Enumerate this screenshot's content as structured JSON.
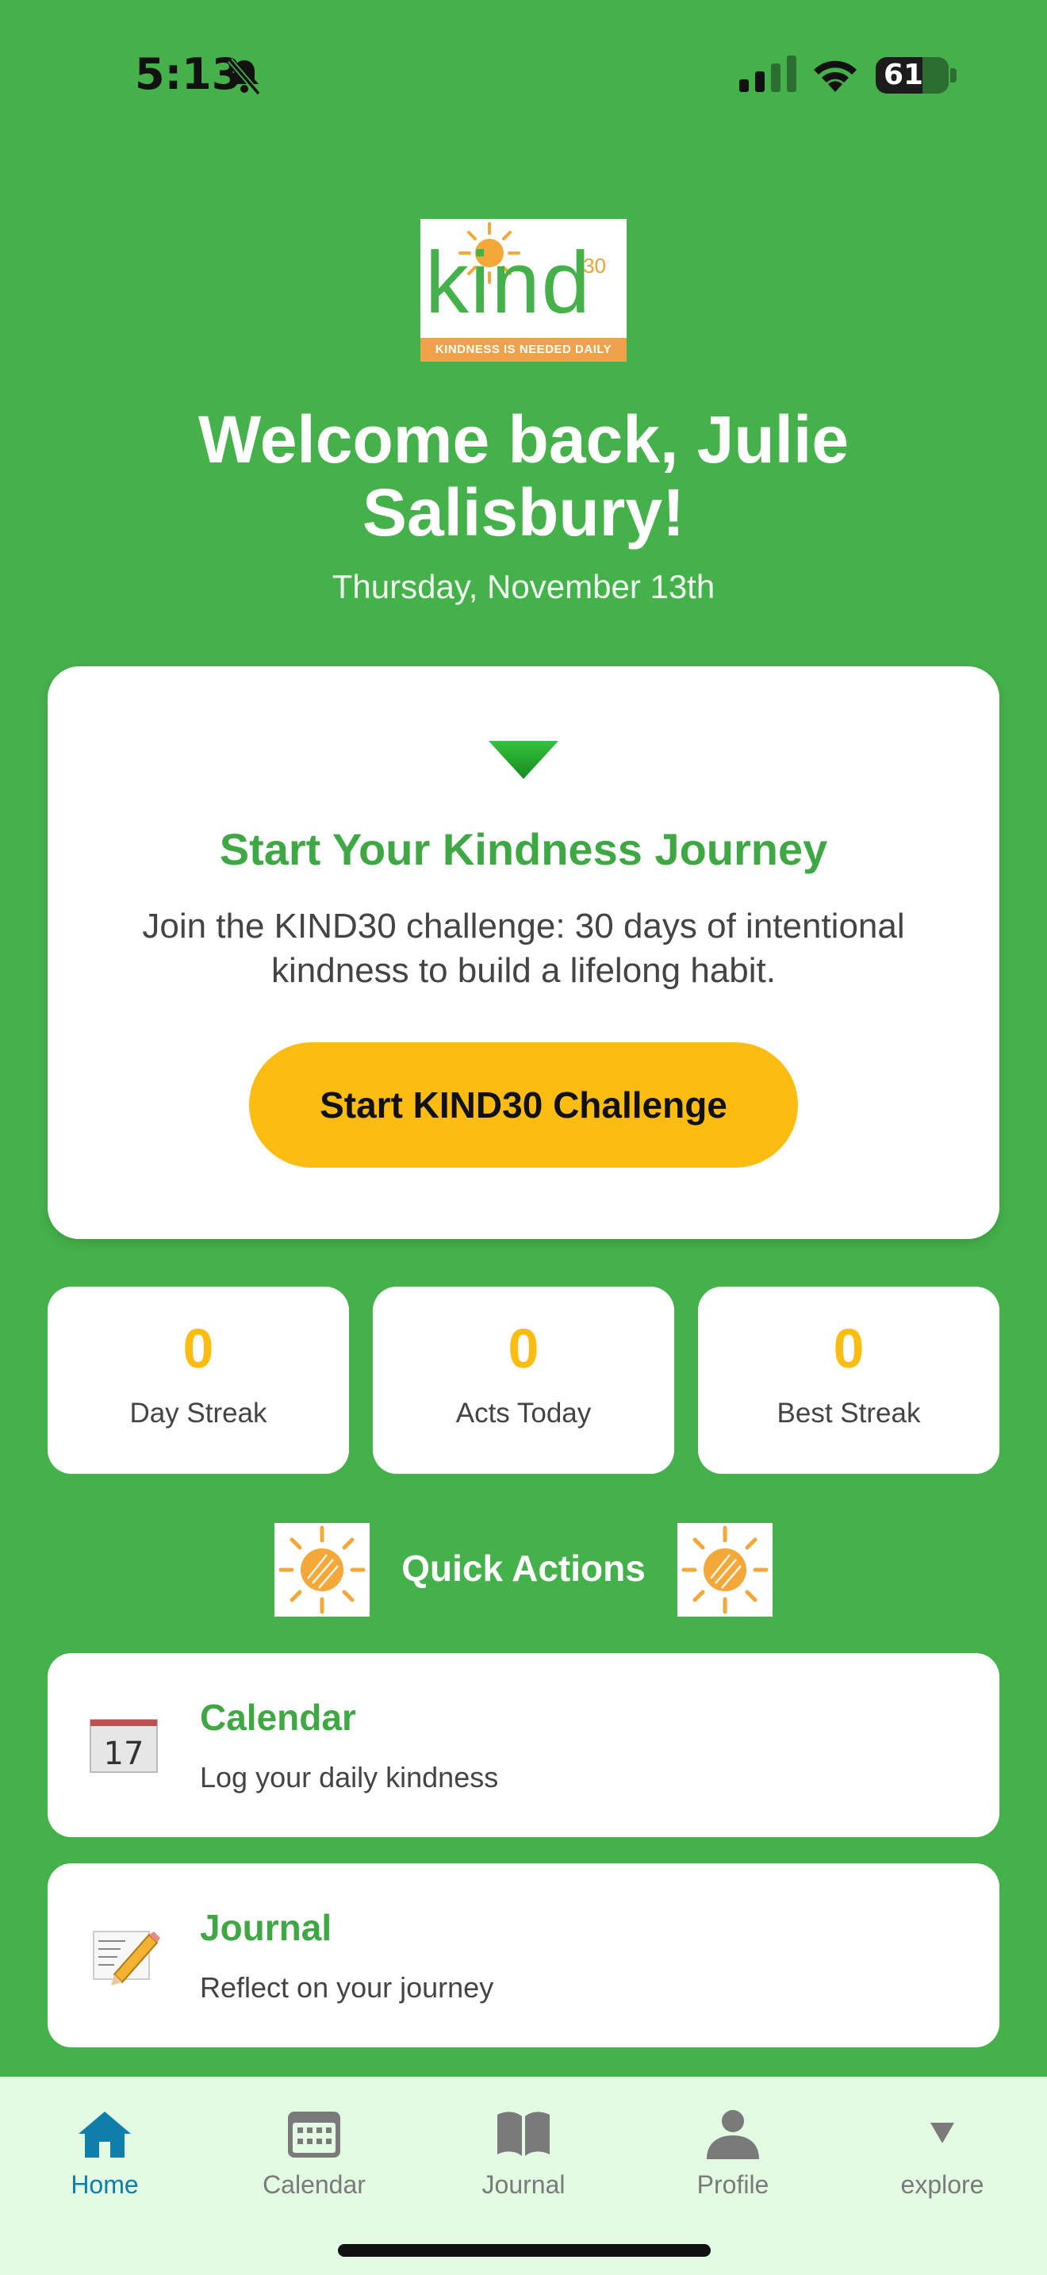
{
  "status_bar": {
    "time": "5:13",
    "battery": "61",
    "battery_level": 0.61
  },
  "logo": {
    "word": "kind",
    "number": "30",
    "tagline": "KINDNESS IS NEEDED DAILY"
  },
  "header": {
    "welcome": "Welcome back, Julie Salisbury!",
    "date": "Thursday, November 13th"
  },
  "journey": {
    "title": "Start Your Kindness Journey",
    "description": "Join the KIND30 challenge: 30 days of intentional kindness to build a lifelong habit.",
    "button_label": "Start KIND30 Challenge"
  },
  "stats": [
    {
      "value": "0",
      "label": "Day Streak"
    },
    {
      "value": "0",
      "label": "Acts Today"
    },
    {
      "value": "0",
      "label": "Best Streak"
    }
  ],
  "quick_actions": {
    "title": "Quick Actions",
    "items": [
      {
        "title": "Calendar",
        "subtitle": "Log your daily kindness",
        "icon": "calendar-icon",
        "icon_text": "17"
      },
      {
        "title": "Journal",
        "subtitle": "Reflect on your journey",
        "icon": "journal-pencil-icon"
      }
    ]
  },
  "tabs": [
    {
      "label": "Home",
      "icon": "home-icon",
      "active": true
    },
    {
      "label": "Calendar",
      "icon": "calendar-icon",
      "active": false
    },
    {
      "label": "Journal",
      "icon": "book-icon",
      "active": false
    },
    {
      "label": "Profile",
      "icon": "person-icon",
      "active": false
    },
    {
      "label": "explore",
      "icon": "triangle-down-icon",
      "active": false
    }
  ],
  "colors": {
    "background": "#45b14a",
    "accent": "#fcbc12",
    "title_green": "#3fa844",
    "tab_active": "#0f7ea8",
    "tab_bar": "#e3fbe3"
  }
}
